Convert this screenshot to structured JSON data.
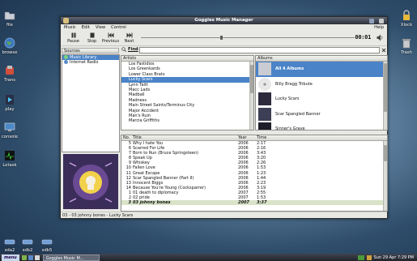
{
  "desktop": {
    "left_icons": [
      {
        "label": "file",
        "icon": "folder-icon"
      },
      {
        "label": "browse",
        "icon": "globe-icon"
      },
      {
        "label": "Trans",
        "icon": "transmission-icon"
      },
      {
        "label": "play",
        "icon": "media-player-icon"
      },
      {
        "label": "console",
        "icon": "monitor-icon"
      },
      {
        "label": "Letask",
        "icon": "activity-icon"
      }
    ],
    "right_icons": [
      {
        "label": "Xlock",
        "icon": "lock-icon"
      },
      {
        "label": "Trash",
        "icon": "trash-icon"
      }
    ],
    "bottom_icons": [
      {
        "label": "sda2"
      },
      {
        "label": "sdb2"
      },
      {
        "label": "sdb5"
      }
    ]
  },
  "window": {
    "title": "Goggles Music Manager",
    "menu": [
      "Music",
      "Edit",
      "View",
      "Control"
    ],
    "help": "Help",
    "toolbar": [
      {
        "label": "Pause",
        "icon": "pause-icon"
      },
      {
        "label": "Stop",
        "icon": "stop-icon"
      },
      {
        "label": "Previous",
        "icon": "previous-icon"
      },
      {
        "label": "Next",
        "icon": "next-icon"
      }
    ],
    "time": "00:01",
    "progress": 0.0,
    "find_label": "Find",
    "sources": {
      "header": "Sources",
      "items": [
        {
          "label": "Music Library",
          "icon": "music-library-icon",
          "selected": true
        },
        {
          "label": "Internet Radio",
          "icon": "radio-icon",
          "selected": false
        }
      ]
    },
    "artists": {
      "header": "Artists",
      "items": [
        "Los Fastidios",
        "Los Greenkards",
        "Lower Class Brats",
        "Lucky Scars",
        "Lynn Taitt",
        "Macc Lads",
        "Madball",
        "Madness",
        "Main Street Saints/Terminus City",
        "Major Accident",
        "Man's Ruin",
        "Marcia Griffiths"
      ],
      "selected_index": 3
    },
    "albums": {
      "header": "Albums",
      "items": [
        {
          "label": "All 4 Albums",
          "selected": true
        },
        {
          "label": "Billy Bragg Tribute"
        },
        {
          "label": "Lucky Scars"
        },
        {
          "label": "Scar Spangled Banner"
        },
        {
          "label": "Sinner's Grave"
        }
      ]
    },
    "songs": {
      "columns": {
        "no": "No.",
        "title": "Title",
        "year": "Year",
        "time": "Time"
      },
      "rows": [
        {
          "no": "5",
          "title": "Why I hate You",
          "year": "2006",
          "time": "2:17"
        },
        {
          "no": "6",
          "title": "Scarred For Life",
          "year": "2006",
          "time": "2:16"
        },
        {
          "no": "7",
          "title": "Born to Run (Bruce Springsteen)",
          "year": "2006",
          "time": "3:43"
        },
        {
          "no": "8",
          "title": "Speak Up",
          "year": "2006",
          "time": "3:20"
        },
        {
          "no": "9",
          "title": "Whiskey",
          "year": "2006",
          "time": "2:26"
        },
        {
          "no": "10",
          "title": "Fallen Love",
          "year": "2006",
          "time": "1:53"
        },
        {
          "no": "11",
          "title": "Great Escape",
          "year": "2006",
          "time": "1:23"
        },
        {
          "no": "12",
          "title": "Scar Spangled Banner (Part II)",
          "year": "2006",
          "time": "1:44"
        },
        {
          "no": "13",
          "title": "Innocent Biggs",
          "year": "2006",
          "time": "2:23"
        },
        {
          "no": "14",
          "title": "Because You're Young (Cocksparrer)",
          "year": "2006",
          "time": "3:19"
        },
        {
          "no": "1",
          "title": "01 death to diplomacy",
          "year": "2007",
          "time": "2:55"
        },
        {
          "no": "2",
          "title": "02 pride",
          "year": "2007",
          "time": "1:53"
        },
        {
          "no": "3",
          "title": "03 johnny bones",
          "year": "2007",
          "time": "3:37"
        }
      ],
      "playing_index": 12
    },
    "status": "03 - 03 johnny bones - Lucky Scars"
  },
  "taskbar": {
    "start": "menu",
    "task": "Goggles Music M...",
    "clock": "Sun 29 Apr  7:29 PM"
  },
  "colors": {
    "selection": "#4a83c7",
    "titlebar": "#2b303a"
  }
}
